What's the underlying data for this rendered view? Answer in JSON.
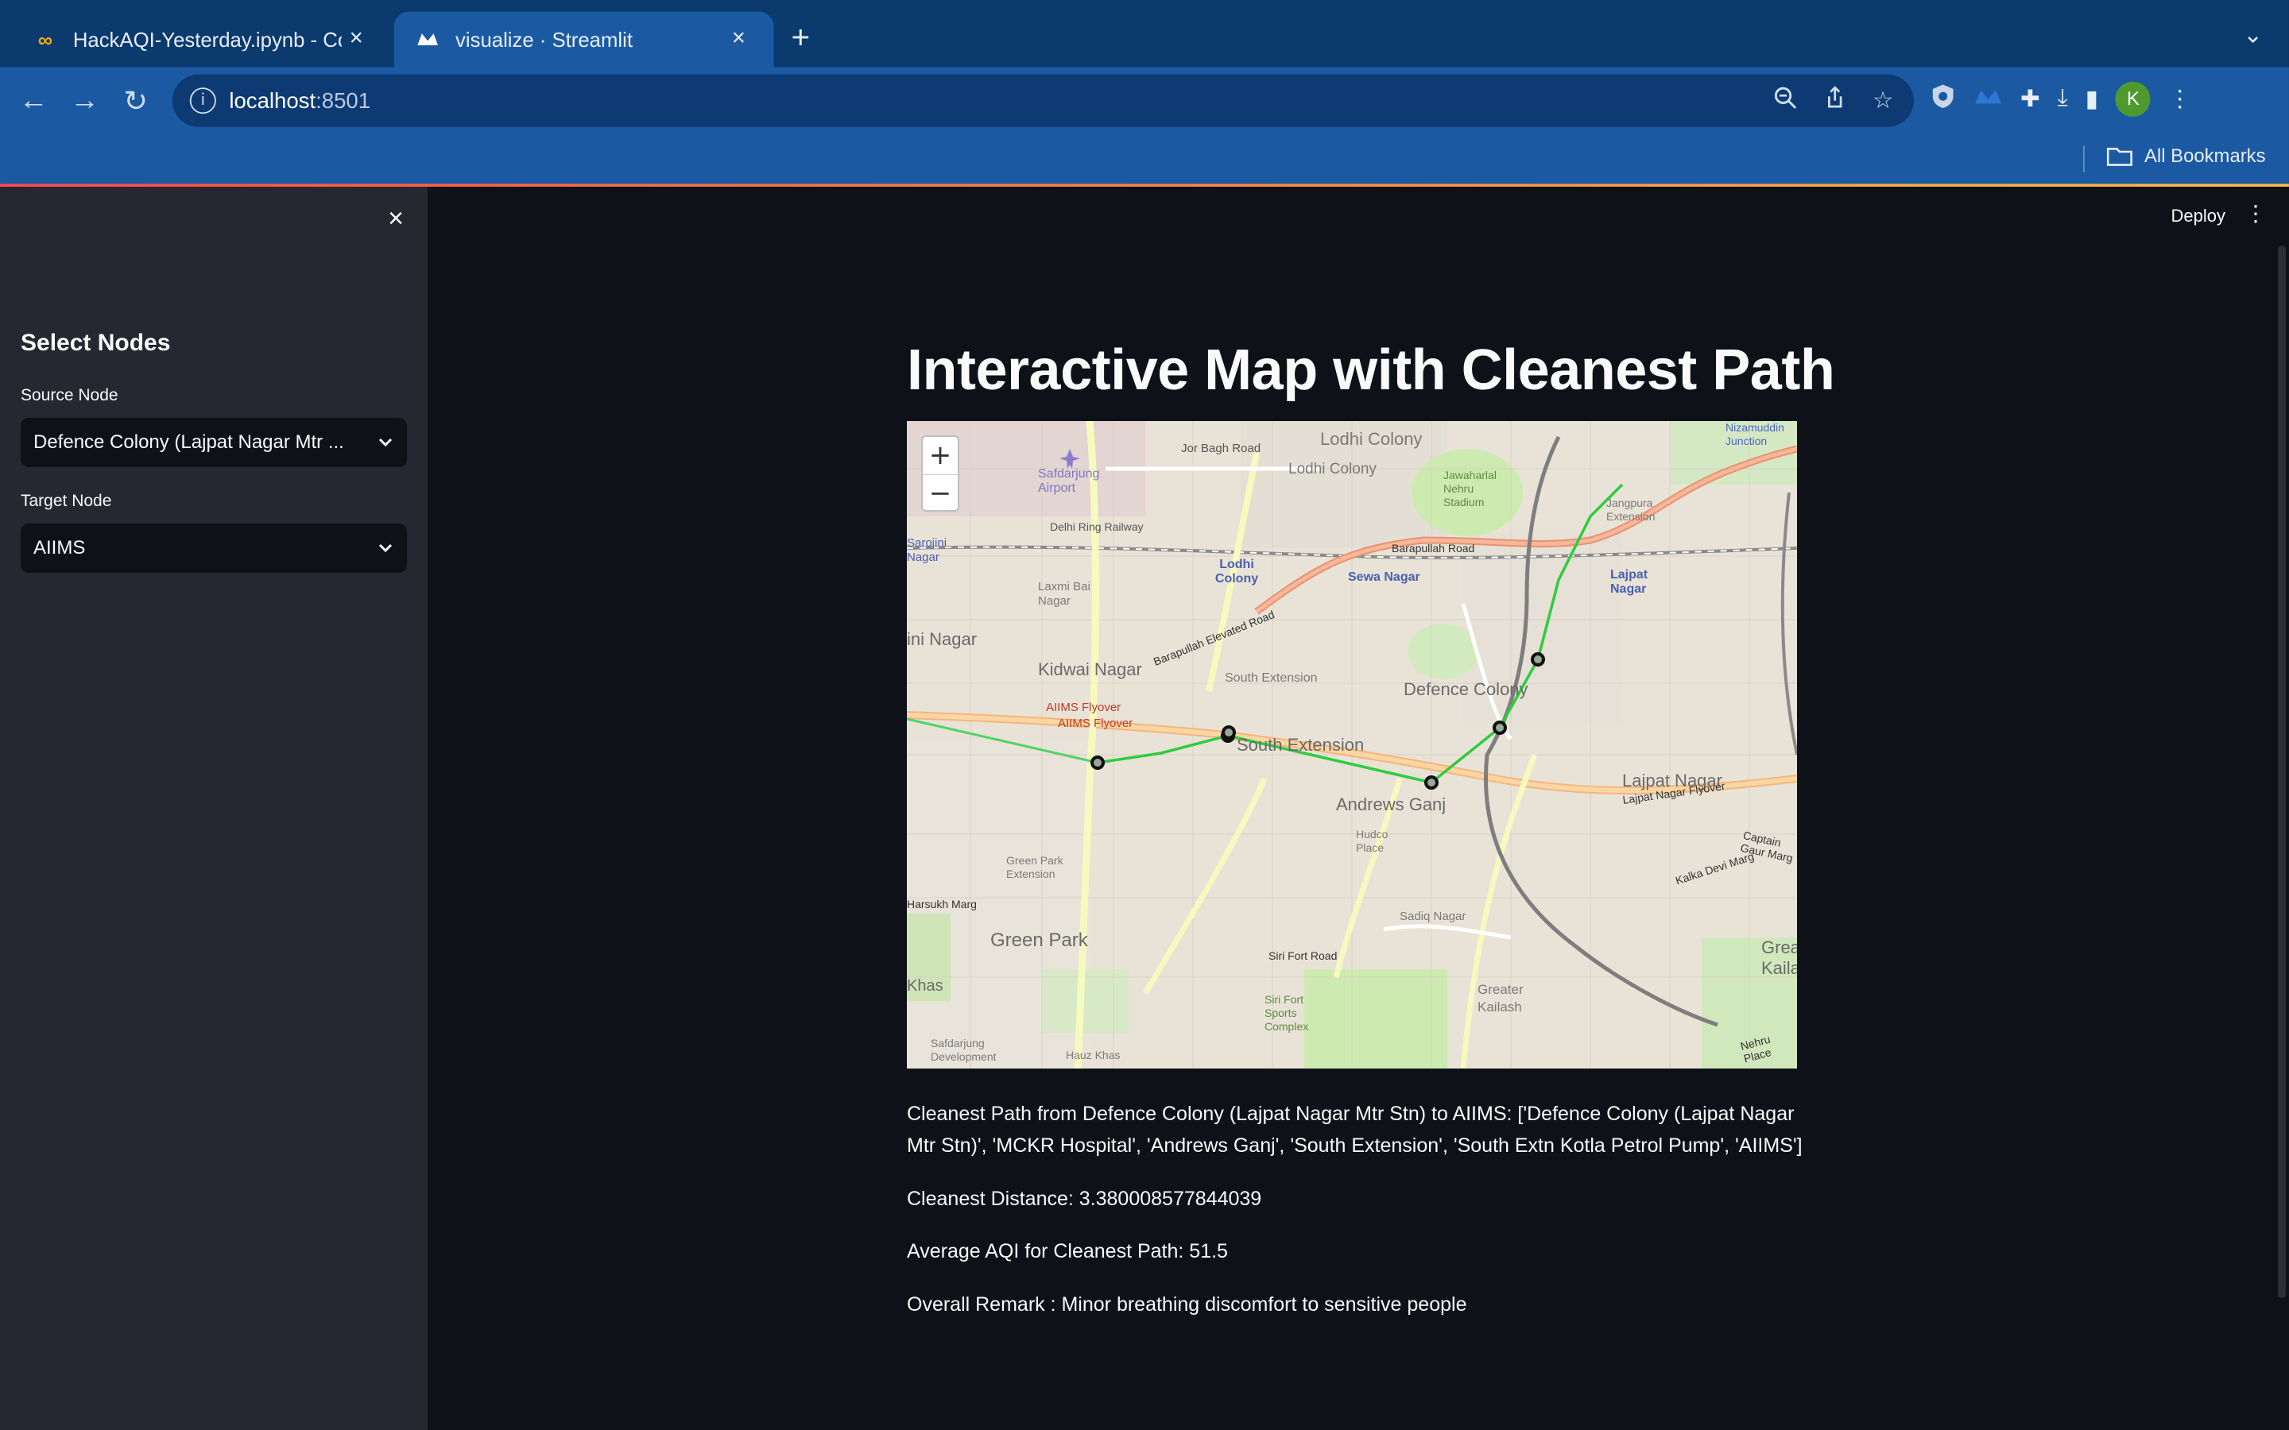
{
  "browser": {
    "tabs": [
      {
        "title": "HackAQI-Yesterday.ipynb - Co",
        "icon": "colab-icon",
        "active": false
      },
      {
        "title": "visualize · Streamlit",
        "icon": "streamlit-icon",
        "active": true
      }
    ],
    "url_host": "localhost",
    "url_port": ":8501",
    "bookmarks_label": "All Bookmarks",
    "profile_initial": "K"
  },
  "app": {
    "deploy_label": "Deploy",
    "sidebar": {
      "heading": "Select Nodes",
      "source_label": "Source Node",
      "source_value": "Defence Colony (Lajpat Nagar Mtr ...",
      "target_label": "Target Node",
      "target_value": "AIIMS"
    },
    "title": "Interactive Map with Cleanest Path",
    "map": {
      "zoom_in": "+",
      "zoom_out": "−",
      "labels": [
        "Lodhi Colony",
        "Lodhi Colony",
        "Safdarjung Airport",
        "Jor Bagh Road",
        "Jawaharlal Nehru Stadium",
        "Jangpura Extension",
        "Nizamuddin Junction",
        "Barapullah Road",
        "Sewa Nagar",
        "Lodhi Colony",
        "Lajpat Nagar",
        "Laxmi Bai Nagar",
        "Kidwai Nagar",
        "Barapullah Elevated Road",
        "South Extension",
        "Defence Colony",
        "AIIMS Flyover",
        "AIIMS Flyover",
        "South Extension",
        "Andrews Ganj",
        "Lajpat Nagar",
        "Lajpat Nagar Flyover",
        "Green Park Extension",
        "Hudco Place",
        "Kalka Devi Marg",
        "Green Park",
        "Sadiq Nagar",
        "Siri Fort Road",
        "Greater Kailash",
        "Siri Fort Sports Complex",
        "Greater Kailash",
        "Hauz Khas",
        "Safdarjung Development",
        "Delhi Ring Railway",
        "Sarojini Nagar",
        "ini Nagar",
        "Khas",
        "Harsukh Marg",
        "Captain Gaur Marg",
        "Nehru Place"
      ]
    },
    "results": {
      "path_text": "Cleanest Path from Defence Colony (Lajpat Nagar Mtr Stn) to AIIMS: ['Defence Colony (Lajpat Nagar Mtr Stn)', 'MCKR Hospital', 'Andrews Ganj', 'South Extension', 'South Extn Kotla Petrol Pump', 'AIIMS']",
      "distance_text": "Cleanest Distance: 3.380008577844039",
      "aqi_text": "Average AQI for Cleanest Path: 51.5",
      "remark_text": "Overall Remark : Minor breathing discomfort to sensitive people"
    }
  }
}
